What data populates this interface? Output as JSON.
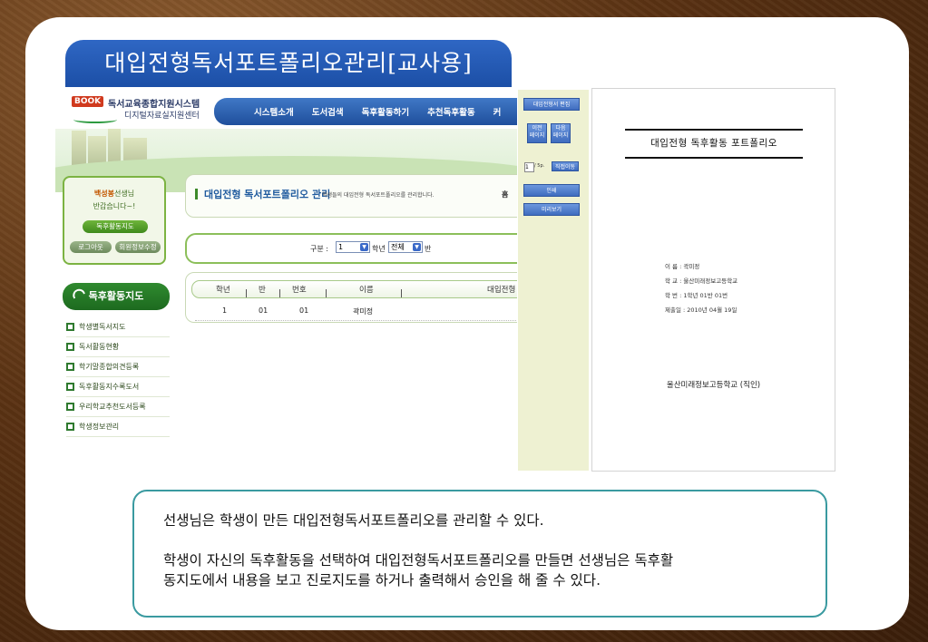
{
  "slide_title": "대입전형독서포트폴리오관리[교사용]",
  "site": {
    "logo_badge": "BOOK",
    "logo_line1": "독서교육종합지원시스템",
    "logo_line2": "디지털자료실지원센터",
    "nav": [
      "시스템소개",
      "도서검색",
      "독후활동하기",
      "추천독후활동",
      "커"
    ]
  },
  "welcome": {
    "name": "백성봉",
    "name_suffix": "선생님",
    "greeting": "반갑습니다~!",
    "map_button": "독후활동지도",
    "logout_button": "로그아웃",
    "profile_button": "회원정보수정"
  },
  "side_menu": {
    "heading": "독후활동지도",
    "items": [
      "학생별독서지도",
      "독서활동현황",
      "학기말종합의견등록",
      "독후활동지수록도서",
      "우리학교추천도서등록",
      "학생정보관리"
    ]
  },
  "page_header": {
    "title": "대입전형 독서포트폴리오 관리",
    "description": "학생들의 대입전형 독서포트폴리오를 관리합니다.",
    "home": "홈"
  },
  "filter": {
    "label": "구분 :",
    "grade_value": "1",
    "grade_suffix": "학년",
    "class_value": "전체",
    "class_suffix": "반"
  },
  "table": {
    "columns": [
      "학년",
      "반",
      "번호",
      "이름",
      "대입전형"
    ],
    "rows": [
      {
        "grade": "1",
        "class": "01",
        "number": "01",
        "name": "곽미정"
      }
    ]
  },
  "toolbar": {
    "edit": "대입전형서 편집",
    "prev": [
      "이전",
      "페이지"
    ],
    "next": [
      "다음",
      "페이지"
    ],
    "page_value": "1",
    "page_total": "/ 5p.",
    "goto": "직접이동",
    "print": "인쇄",
    "preview": "미리보기"
  },
  "preview_doc": {
    "title": "대입전형 독후활동 포트폴리오",
    "name": "이 름 : 곽미정",
    "school": "학 교 : 울산미래정보고등학교",
    "student_no": "학 번 : 1학년 01반 01번",
    "submitted": "제출일 : 2010년 04월 19일",
    "seal": "울산미래정보고등학교 (직인)"
  },
  "note": {
    "line1": "선생님은 학생이 만든 대입전형독서포트폴리오를 관리할 수 있다.",
    "line2": "학생이 자신의 독후활동을 선택하여 대입전형독서포트폴리오를 만들면 선생님은 독후활",
    "line3": "동지도에서 내용을 보고 진로지도를 하거나 출력해서 승인을 해 줄 수 있다."
  }
}
